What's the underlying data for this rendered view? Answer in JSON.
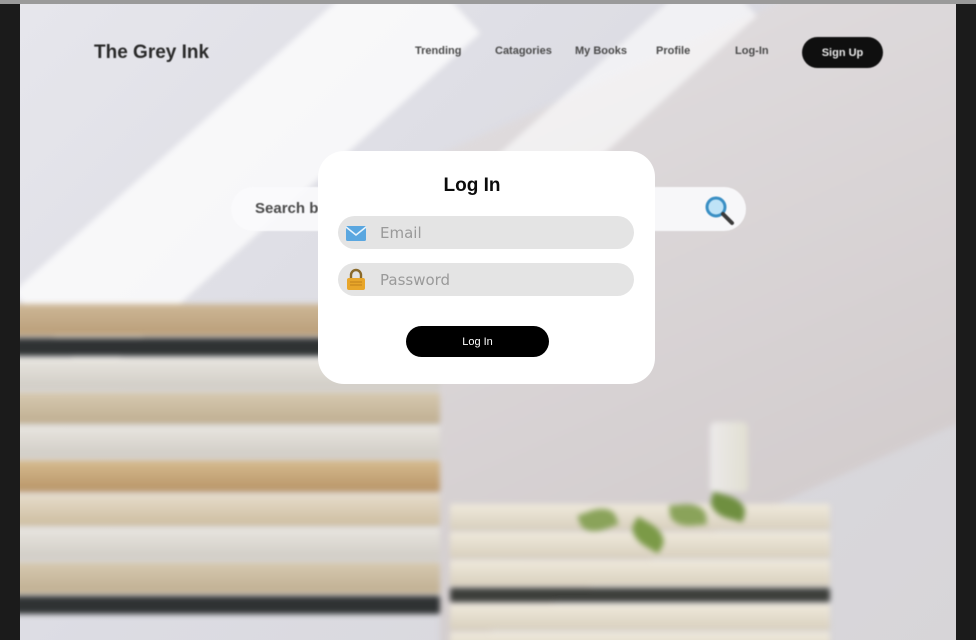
{
  "brand": {
    "name": "The Grey Ink"
  },
  "nav": {
    "links": [
      "Trending",
      "Catagories",
      "My Books",
      "Profile",
      "Log-In"
    ],
    "signup_label": "Sign Up"
  },
  "search": {
    "text": "Search b"
  },
  "modal": {
    "title": "Log In",
    "email_placeholder": "Email",
    "password_placeholder": "Password",
    "submit_label": "Log In"
  },
  "icons": {
    "email": "envelope-icon",
    "password": "padlock-icon",
    "search": "magnifier-icon"
  },
  "colors": {
    "accent": "#000000",
    "modal_bg": "#ffffff",
    "field_bg": "#e4e4e4"
  }
}
